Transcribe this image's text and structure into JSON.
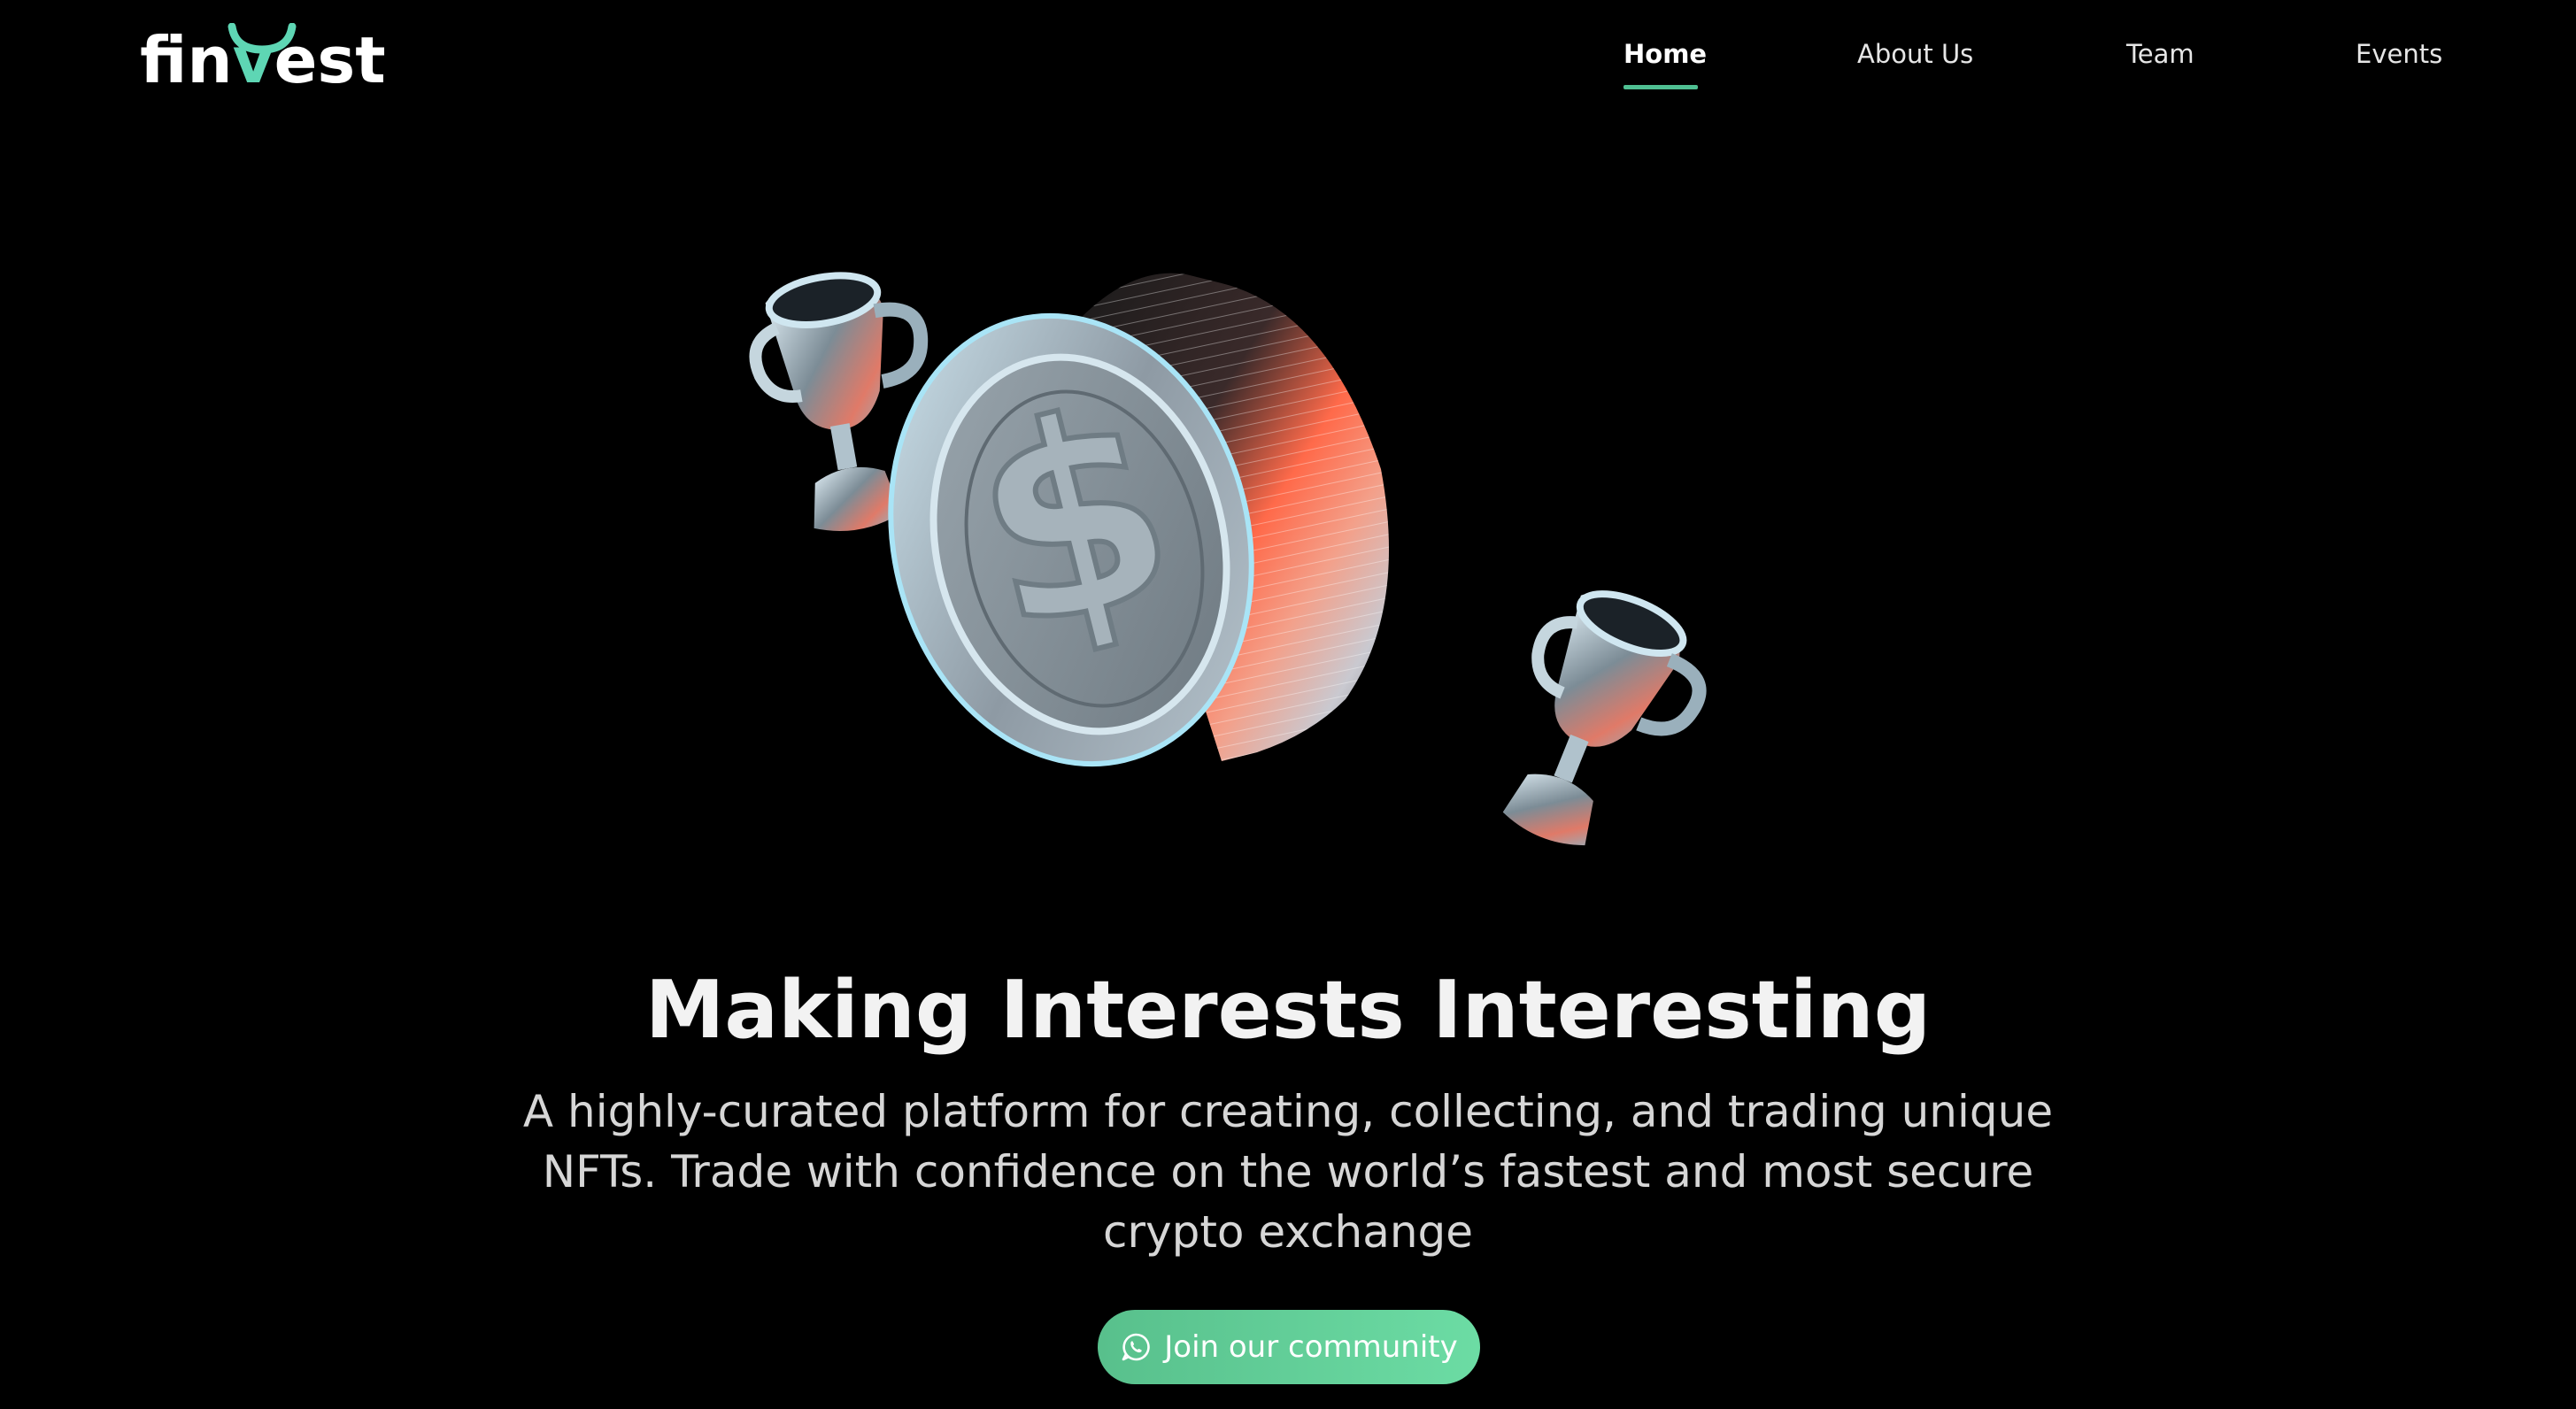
{
  "brand": {
    "logo_text_before": "fin",
    "logo_text_accent": "v",
    "logo_text_after": "est",
    "accent_color": "#5ed6b4"
  },
  "nav": {
    "items": [
      {
        "label": "Home",
        "active": true
      },
      {
        "label": "About Us",
        "active": false
      },
      {
        "label": "Team",
        "active": false
      },
      {
        "label": "Events",
        "active": false
      }
    ],
    "active_underline_color": "#4fbf92"
  },
  "hero": {
    "illustration": {
      "coin_icon": "dollar-coin-icon",
      "trophy_icon": "trophy-icon"
    },
    "headline": "Making Interests Interesting",
    "subtext": "A highly-curated platform for creating, collecting, and trading unique NFTs. Trade with confidence on the world’s fastest and most secure crypto exchange",
    "cta": {
      "label": "Join our community",
      "icon": "whatsapp-icon",
      "color_start": "#58c08c",
      "color_end": "#6cdca4"
    }
  }
}
